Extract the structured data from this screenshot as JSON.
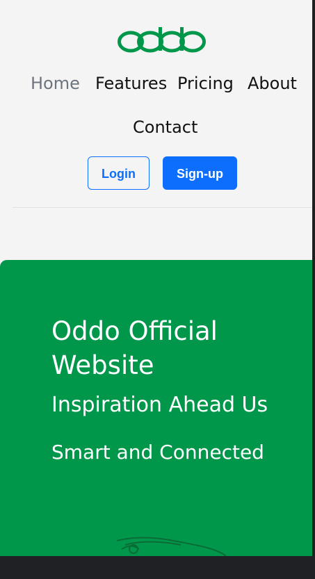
{
  "brand": {
    "logo_text": "oddo",
    "color": "#01974b"
  },
  "nav": {
    "items": [
      {
        "label": "Home",
        "active": true
      },
      {
        "label": "Features",
        "active": false
      },
      {
        "label": "Pricing",
        "active": false
      },
      {
        "label": "About",
        "active": false
      },
      {
        "label": "Contact",
        "active": false
      }
    ]
  },
  "auth": {
    "login_label": "Login",
    "signup_label": "Sign-up",
    "accent": "#0d6efd"
  },
  "hero": {
    "title": "Oddo Official Website",
    "subtitle": "Inspiration Ahead Us",
    "tagline": "Smart and Connected",
    "background": "#01974b",
    "illustration": "phone-outline-icon"
  }
}
